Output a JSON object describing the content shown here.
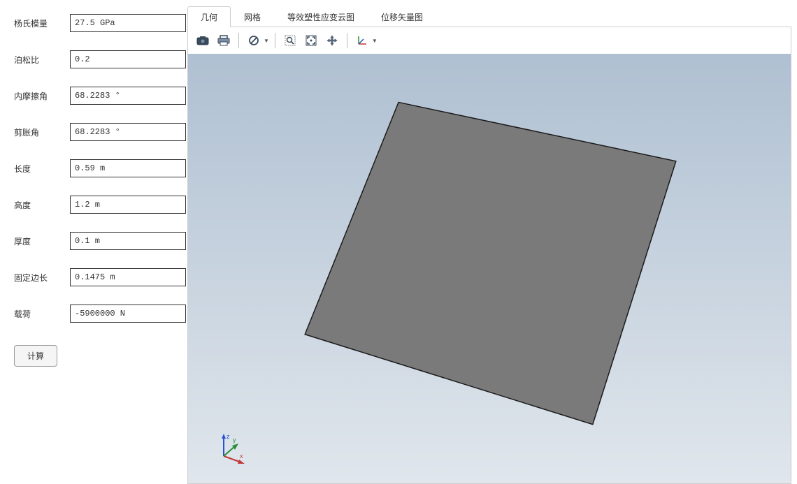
{
  "form": {
    "fields": [
      {
        "label": "杨氏模量",
        "value": "27.5 GPa"
      },
      {
        "label": "泊松比",
        "value": "0.2"
      },
      {
        "label": "内摩擦角",
        "value": "68.2283 °"
      },
      {
        "label": "剪胀角",
        "value": "68.2283 °"
      },
      {
        "label": "长度",
        "value": "0.59 m"
      },
      {
        "label": "高度",
        "value": "1.2 m"
      },
      {
        "label": "厚度",
        "value": "0.1 m"
      },
      {
        "label": "固定边长",
        "value": "0.1475 m"
      },
      {
        "label": "载荷",
        "value": "-5900000 N"
      }
    ],
    "calc_button": "计算"
  },
  "tabs": [
    {
      "label": "几何",
      "active": true
    },
    {
      "label": "网格",
      "active": false
    },
    {
      "label": "等效塑性应变云图",
      "active": false
    },
    {
      "label": "位移矢量图",
      "active": false
    }
  ],
  "toolbar": {
    "camera": "camera-icon",
    "print": "print-icon",
    "undo": "no-symbol-icon",
    "zoom_box": "zoom-box-icon",
    "zoom_fit": "zoom-fit-icon",
    "pan": "pan-icon",
    "axes": "axes-icon"
  },
  "axis_labels": {
    "x": "x",
    "y": "y",
    "z": "z"
  }
}
